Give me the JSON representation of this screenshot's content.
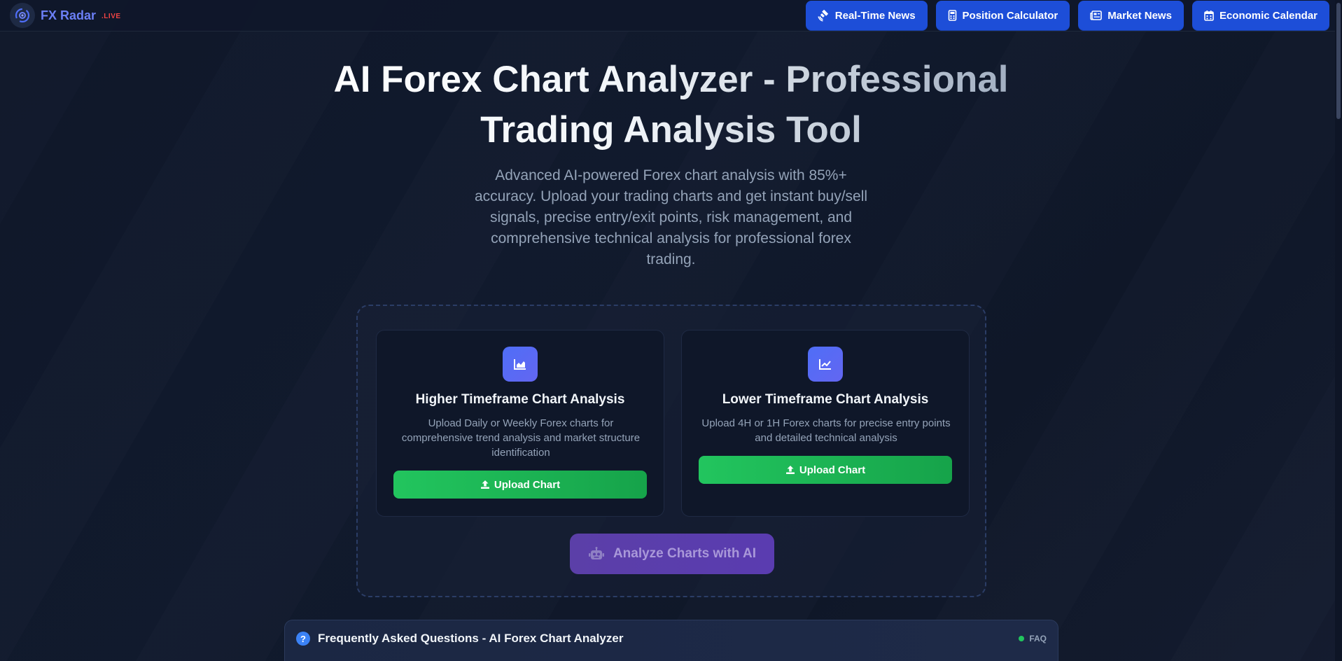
{
  "brand": {
    "name": "FX Radar",
    "badge": ".LIVE"
  },
  "nav": [
    {
      "label": "Real-Time News",
      "icon": "satellite-icon"
    },
    {
      "label": "Position Calculator",
      "icon": "calculator-icon"
    },
    {
      "label": "Market News",
      "icon": "newspaper-icon"
    },
    {
      "label": "Economic Calendar",
      "icon": "calendar-icon"
    }
  ],
  "hero": {
    "title": "AI Forex Chart Analyzer - Professional Trading Analysis Tool",
    "subtitle": "Advanced AI-powered Forex chart analysis with 85%+ accuracy. Upload your trading charts and get instant buy/sell signals, precise entry/exit points, risk management, and comprehensive technical analysis for professional forex trading."
  },
  "cards": [
    {
      "icon": "area-chart-icon",
      "title": "Higher Timeframe Chart Analysis",
      "description": "Upload Daily or Weekly Forex charts for comprehensive trend analysis and market structure identification",
      "button": "Upload Chart"
    },
    {
      "icon": "line-chart-icon",
      "title": "Lower Timeframe Chart Analysis",
      "description": "Upload 4H or 1H Forex charts for precise entry points and detailed technical analysis",
      "button": "Upload Chart"
    }
  ],
  "analyze_button": {
    "label": "Analyze Charts with AI",
    "icon": "robot-icon"
  },
  "faq": {
    "icon_glyph": "?",
    "title": "Frequently Asked Questions - AI Forex Chart Analyzer",
    "badge": "FAQ"
  },
  "colors": {
    "background": "#0f172a",
    "nav_button": "#1d4ed8",
    "upload_button": "#22c55e",
    "analyze_button": "#5b3fa8",
    "brand": "#6b7ff5",
    "live": "#ef4444"
  }
}
